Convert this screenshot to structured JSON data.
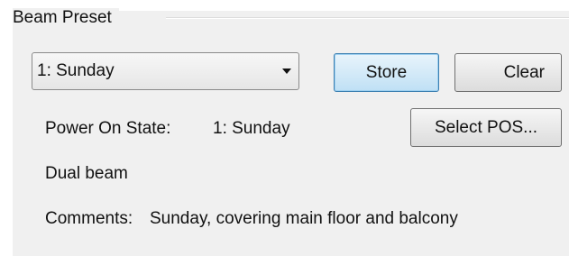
{
  "group": {
    "title": "Beam Preset"
  },
  "preset_select": {
    "value": "1: Sunday",
    "icon": "chevron-down-icon"
  },
  "buttons": {
    "store_label": "Store",
    "clear_label": "Clear",
    "select_pos_label": "Select POS..."
  },
  "power_on_state": {
    "label": "Power On State:",
    "value": "1: Sunday"
  },
  "beam_mode": "Dual beam",
  "comments": {
    "label": "Comments:",
    "value": "Sunday, covering main floor and balcony"
  },
  "colors": {
    "panel_background": "#f0f0f0",
    "store_button_accent": "#bfe0f5"
  }
}
